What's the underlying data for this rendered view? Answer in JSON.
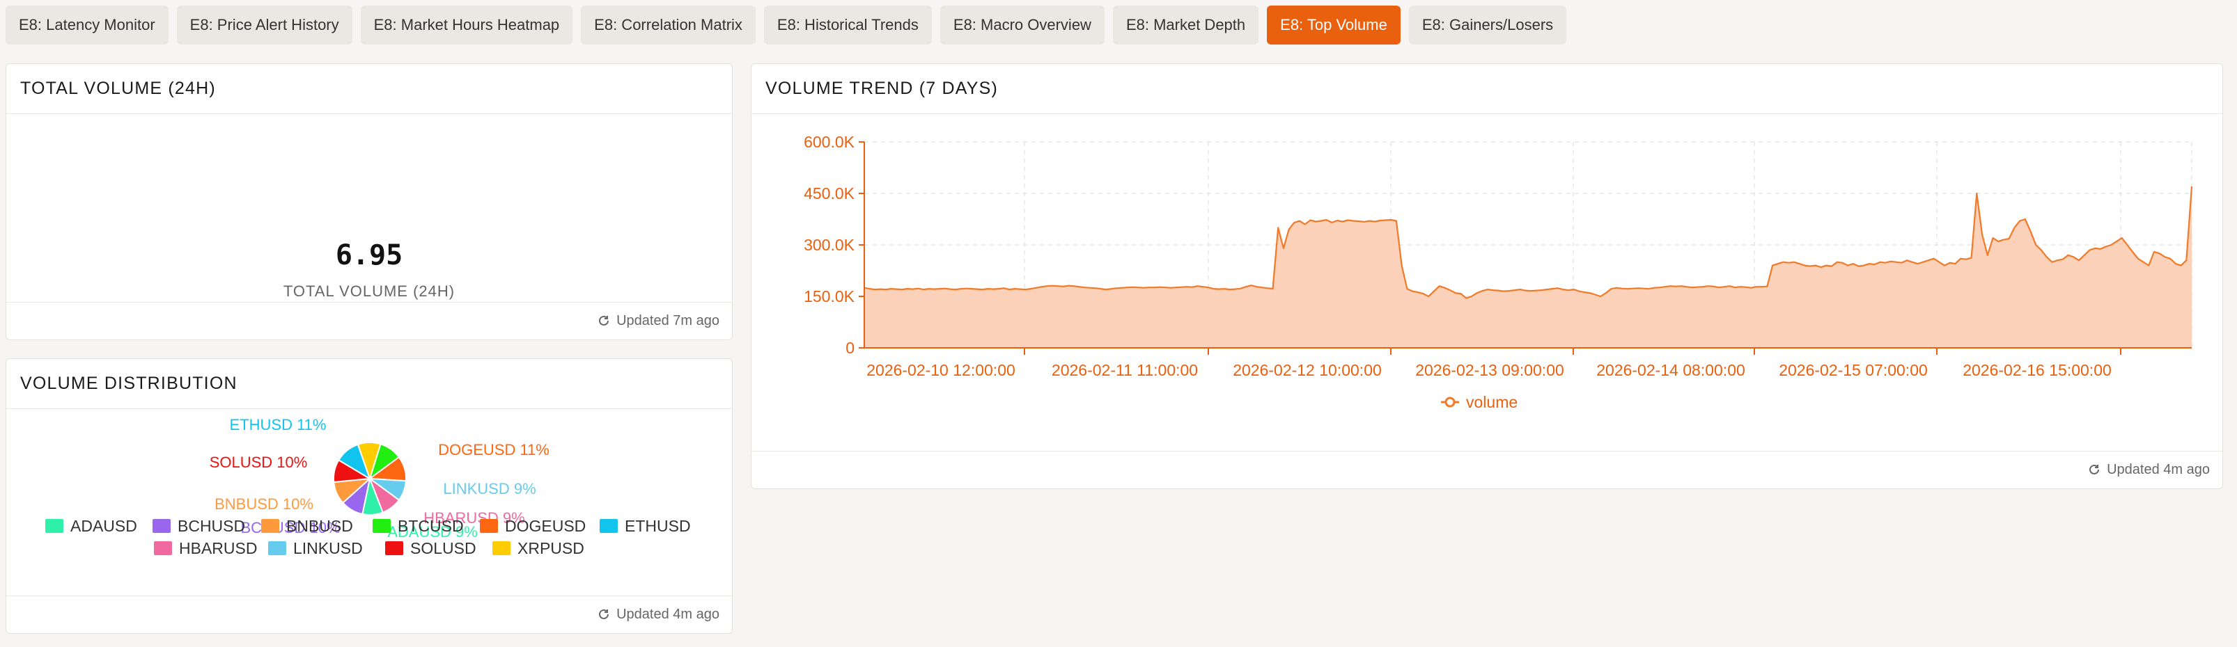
{
  "tabs": [
    {
      "label": "E8: Latency Monitor",
      "active": false
    },
    {
      "label": "E8: Price Alert History",
      "active": false
    },
    {
      "label": "E8: Market Hours Heatmap",
      "active": false
    },
    {
      "label": "E8: Correlation Matrix",
      "active": false
    },
    {
      "label": "E8: Historical Trends",
      "active": false
    },
    {
      "label": "E8: Macro Overview",
      "active": false
    },
    {
      "label": "E8: Market Depth",
      "active": false
    },
    {
      "label": "E8: Top Volume",
      "active": true
    },
    {
      "label": "E8: Gainers/Losers",
      "active": false
    }
  ],
  "total_volume": {
    "title": "TOTAL VOLUME (24H)",
    "value": "6.95",
    "label": "TOTAL VOLUME (24H)",
    "updated": "Updated 7m ago"
  },
  "distribution": {
    "title": "VOLUME DISTRIBUTION",
    "updated": "Updated 4m ago"
  },
  "trend": {
    "title": "VOLUME TREND (7 DAYS)",
    "updated": "Updated 4m ago"
  },
  "colors": {
    "accent": "#e9600f",
    "line": "#f07a28",
    "area": "#fcd1b9"
  },
  "chart_data": [
    {
      "type": "pie",
      "categories": [
        "ADAUSD",
        "BCHUSD",
        "BNBUSD",
        "BTCUSD",
        "DOGEUSD",
        "ETHUSD",
        "HBARUSD",
        "LINKUSD",
        "SOLUSD",
        "XRPUSD"
      ],
      "values": [
        9,
        10,
        10,
        10,
        11,
        11,
        9,
        9,
        10,
        10
      ],
      "colors": [
        "#2ef0a8",
        "#9966ee",
        "#ff9a3c",
        "#22ee11",
        "#ff6611",
        "#11c4ee",
        "#f06aa0",
        "#66ccee",
        "#ee1111",
        "#ffcc00"
      ],
      "labels": [
        {
          "text": "ETHUSD 11%",
          "color": "#11c4ee"
        },
        {
          "text": "DOGEUSD 11%",
          "color": "#ff6611"
        },
        {
          "text": "SOLUSD 10%",
          "color": "#ee1111"
        },
        {
          "text": "LINKUSD 9%",
          "color": "#66ccee"
        },
        {
          "text": "BNBUSD 10%",
          "color": "#ff9a3c"
        },
        {
          "text": "HBARUSD 9%",
          "color": "#f06aa0"
        },
        {
          "text": "BCHUSD 10%",
          "color": "#9966ee"
        },
        {
          "text": "ADAUSD 9%",
          "color": "#2ef0a8"
        }
      ],
      "legend_position": "bottom"
    },
    {
      "type": "area",
      "series": [
        {
          "name": "volume",
          "values": [
            175000,
            172000,
            170000,
            171000,
            170000,
            172000,
            171000,
            170000,
            172000,
            171000,
            173000,
            170000,
            172000,
            171000,
            172000,
            173000,
            171000,
            170000,
            172000,
            173000,
            172000,
            171000,
            170000,
            172000,
            171000,
            172000,
            174000,
            170000,
            172000,
            171000,
            170000,
            172000,
            175000,
            178000,
            180000,
            181000,
            180000,
            179000,
            181000,
            180000,
            178000,
            176000,
            175000,
            174000,
            172000,
            170000,
            172000,
            174000,
            175000,
            176000,
            177000,
            176000,
            175000,
            176000,
            176000,
            177000,
            176000,
            175000,
            176000,
            177000,
            178000,
            177000,
            180000,
            178000,
            176000,
            172000,
            171000,
            172000,
            170000,
            171000,
            173000,
            178000,
            182000,
            178000,
            176000,
            174000,
            172000,
            350000,
            290000,
            345000,
            365000,
            370000,
            360000,
            372000,
            368000,
            370000,
            373000,
            365000,
            371000,
            368000,
            372000,
            370000,
            369000,
            367000,
            370000,
            368000,
            371000,
            372000,
            373000,
            370000,
            240000,
            172000,
            165000,
            162000,
            158000,
            150000,
            165000,
            180000,
            175000,
            168000,
            160000,
            158000,
            145000,
            150000,
            160000,
            166000,
            170000,
            168000,
            167000,
            165000,
            166000,
            168000,
            170000,
            167000,
            166000,
            167000,
            168000,
            170000,
            172000,
            174000,
            170000,
            168000,
            170000,
            165000,
            162000,
            160000,
            155000,
            150000,
            160000,
            172000,
            175000,
            173000,
            172000,
            173000,
            174000,
            173000,
            172000,
            175000,
            176000,
            178000,
            180000,
            179000,
            180000,
            178000,
            176000,
            177000,
            178000,
            180000,
            179000,
            176000,
            178000,
            180000,
            176000,
            178000,
            177000,
            175000,
            178000,
            178000,
            179000,
            240000,
            245000,
            250000,
            248000,
            250000,
            245000,
            240000,
            238000,
            240000,
            235000,
            240000,
            238000,
            250000,
            248000,
            240000,
            245000,
            238000,
            240000,
            245000,
            243000,
            250000,
            248000,
            252000,
            250000,
            248000,
            255000,
            250000,
            245000,
            250000,
            255000,
            260000,
            250000,
            240000,
            248000,
            245000,
            260000,
            258000,
            262000,
            450000,
            330000,
            270000,
            320000,
            310000,
            315000,
            318000,
            350000,
            370000,
            375000,
            340000,
            300000,
            285000,
            265000,
            250000,
            255000,
            258000,
            270000,
            265000,
            255000,
            270000,
            285000,
            290000,
            288000,
            295000,
            300000,
            310000,
            320000,
            300000,
            280000,
            260000,
            250000,
            240000,
            280000,
            275000,
            265000,
            260000,
            245000,
            240000,
            255000,
            470000
          ]
        }
      ],
      "x_labels": [
        "2026-02-10 12:00:00",
        "2026-02-11 11:00:00",
        "2026-02-12 10:00:00",
        "2026-02-13 09:00:00",
        "2026-02-14 08:00:00",
        "2026-02-15 07:00:00",
        "2026-02-16 15:00:00"
      ],
      "y_ticks": [
        "0",
        "150.0K",
        "300.0K",
        "450.0K",
        "600.0K"
      ],
      "ylim": [
        0,
        600000
      ],
      "grid": true,
      "legend_position": "bottom"
    }
  ]
}
